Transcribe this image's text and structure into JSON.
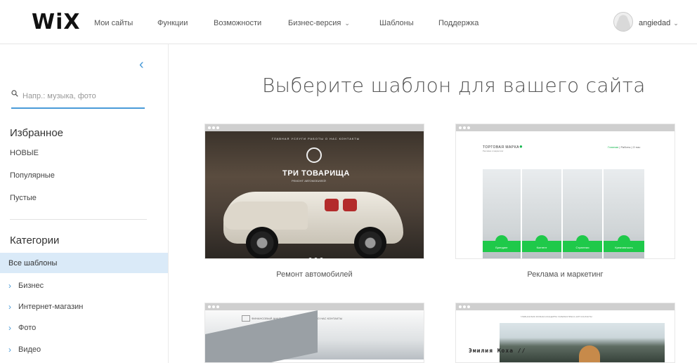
{
  "logo": "WiX",
  "nav": {
    "items": [
      "Мои сайты",
      "Функции",
      "Возможности",
      "Бизнес-версия",
      "Шаблоны",
      "Поддержка"
    ],
    "user": "angiedad"
  },
  "sidebar": {
    "search_placeholder": "Напр.: музыка, фото",
    "favorites_title": "Избранное",
    "favorites": [
      "НОВЫЕ",
      "Популярные",
      "Пустые"
    ],
    "categories_title": "Категории",
    "active_category": "Все шаблоны",
    "categories": [
      "Бизнес",
      "Интернет-магазин",
      "Фото",
      "Видео"
    ]
  },
  "main": {
    "heading": "Выберите шаблон для вашего сайта",
    "templates": [
      {
        "caption": "Ремонт автомобилей",
        "preview_title": "ТРИ ТОВАРИЩА",
        "preview_subtitle": "РЕМОНТ АВТОМОБИЛЕЙ",
        "preview_nav": "ГЛАВНАЯ  УСЛУГИ  РАБОТЫ  О НАС  КОНТАКТЫ"
      },
      {
        "caption": "Реклама и маркетинг",
        "brand": "ТОРГОВАЯ МАРКА",
        "brand_sub": "Реклама и маркетинг",
        "links": [
          "Главная",
          "Работы",
          "О нас"
        ],
        "panels": [
          "Брендинг",
          "Контент",
          "Стратегии",
          "Креативность"
        ]
      },
      {
        "caption": "",
        "preview_nav": "ФИНАНСОВЫЙ АНАЛИЗ   ГЛАВНАЯ   ПОРТФОЛИО   О НАС   КОНТАКТЫ"
      },
      {
        "caption": "",
        "preview_name": "Эмилия Коха //",
        "preview_nav": "ГЛАВНАЯ  БИО  МУЗЫКА  КОНЦЕРТЫ  ГАЛЕРЕЯ  ПРЕСС-КИТ  КОНТАКТЫ"
      }
    ]
  },
  "colors": {
    "accent": "#4a9bd8",
    "active_bg": "#daeaf8",
    "green": "#1fc94a"
  }
}
